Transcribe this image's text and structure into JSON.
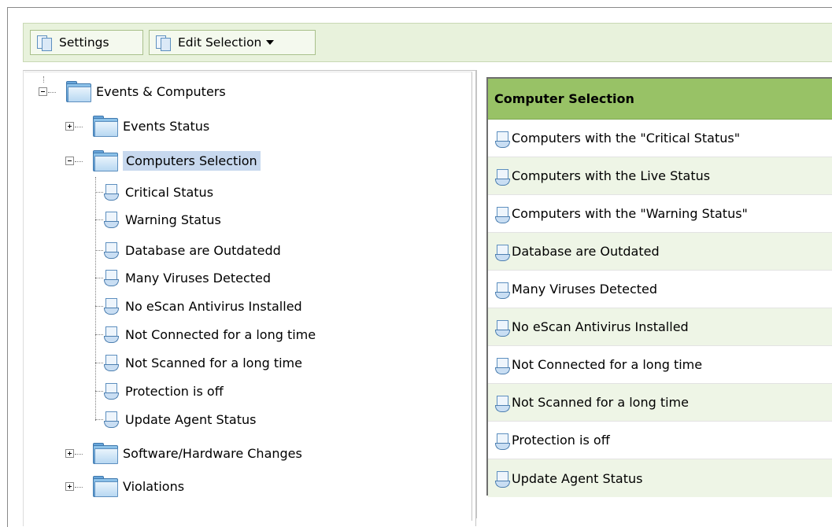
{
  "toolbar": {
    "settings_label": "Settings",
    "settings_icon": "document-icon",
    "edit_selection_label": "Edit Selection",
    "edit_selection_icon": "document-icon"
  },
  "tree": {
    "root": {
      "label": "Events & Computers",
      "expanded": true
    },
    "items": [
      {
        "label": "Events Status",
        "expanded": false
      },
      {
        "label": "Computers Selection",
        "expanded": true,
        "selected": true,
        "children": [
          "Critical Status",
          "Warning Status",
          "Database are Outdatedd",
          "Many Viruses Detected",
          "No eScan Antivirus Installed",
          "Not Connected for a long time",
          "Not Scanned for a long time",
          "Protection is off",
          "Update Agent Status"
        ]
      },
      {
        "label": "Software/Hardware Changes",
        "expanded": false
      },
      {
        "label": "Violations",
        "expanded": false
      }
    ]
  },
  "panel": {
    "title": "Computer Selection",
    "rows": [
      "Computers with the \"Critical Status\"",
      "Computers with the Live Status",
      "Computers with the \"Warning Status\"",
      "Database are Outdated",
      "Many Viruses Detected",
      "No eScan Antivirus Installed",
      "Not Connected for a long time",
      "Not Scanned for a long time",
      "Protection is off",
      "Update Agent Status"
    ]
  },
  "colors": {
    "toolbar_bg": "#e8f2dc",
    "panel_header": "#98c266",
    "alt_row": "#eef5e6",
    "selection": "#c7d8ee"
  }
}
